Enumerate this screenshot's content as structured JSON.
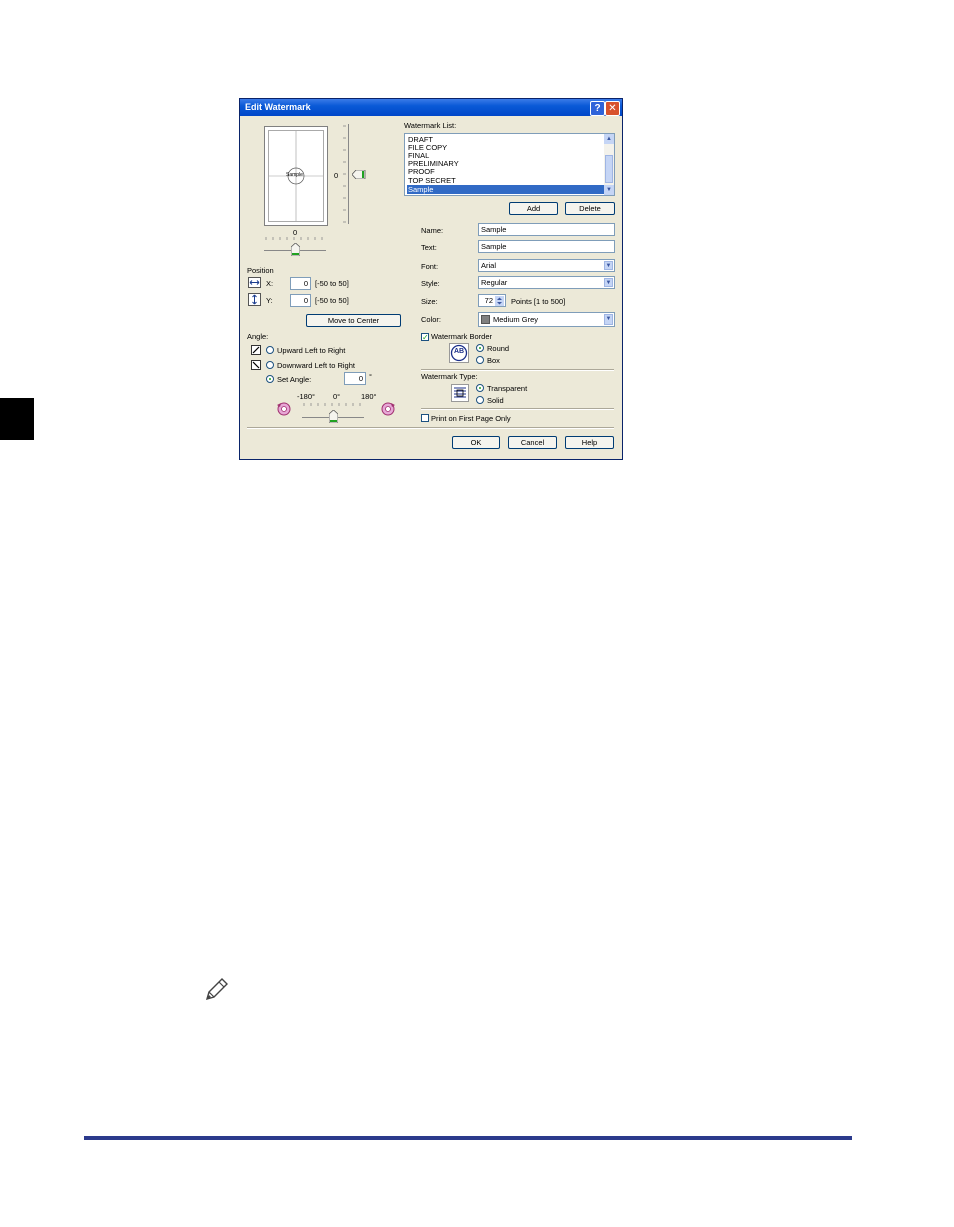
{
  "dialog": {
    "title": "Edit Watermark",
    "help_glyph": "?",
    "close_glyph": "✕"
  },
  "preview": {
    "sample_text": "Sample",
    "vertical_value": "0",
    "horizontal_value": "0"
  },
  "position": {
    "label": "Position",
    "x_label": "X:",
    "x_value": "0",
    "x_range": "[-50 to 50]",
    "y_label": "Y:",
    "y_value": "0",
    "y_range": "[-50 to 50]",
    "move_center": "Move to Center"
  },
  "angle": {
    "label": "Angle:",
    "upward": "Upward Left to Right",
    "downward": "Downward Left to Right",
    "set_angle": "Set Angle:",
    "value": "0",
    "degree": "°",
    "min_label": "-180°",
    "mid_label": "0°",
    "max_label": "180°",
    "selected": "set_angle"
  },
  "watermark_list": {
    "label": "Watermark List:",
    "items": [
      "DRAFT",
      "FILE COPY",
      "FINAL",
      "PRELIMINARY",
      "PROOF",
      "TOP SECRET",
      "Sample"
    ],
    "selected": "Sample",
    "add": "Add",
    "delete": "Delete"
  },
  "form": {
    "name_label": "Name:",
    "name_value": "Sample",
    "text_label": "Text:",
    "text_value": "Sample",
    "font_label": "Font:",
    "font_value": "Arial",
    "style_label": "Style:",
    "style_value": "Regular",
    "size_label": "Size:",
    "size_value": "72",
    "size_range": "Points [1 to 500]",
    "color_label": "Color:",
    "color_value": "Medium Grey",
    "color_swatch": "#808080"
  },
  "border": {
    "label": "Watermark Border",
    "checked": true,
    "icon_text": "AB",
    "round": "Round",
    "box": "Box",
    "selected": "round"
  },
  "type": {
    "label": "Watermark Type:",
    "transparent": "Transparent",
    "solid": "Solid",
    "selected": "transparent"
  },
  "first_page": {
    "label": "Print on First Page Only",
    "checked": false
  },
  "buttons": {
    "ok": "OK",
    "cancel": "Cancel",
    "help": "Help"
  },
  "colors": {
    "dialog_bg": "#ece9d8",
    "titlebar": "#0a5ad7",
    "selection": "#316ac5",
    "footer_rule": "#2b3a8c",
    "side_tab": "#000000"
  }
}
